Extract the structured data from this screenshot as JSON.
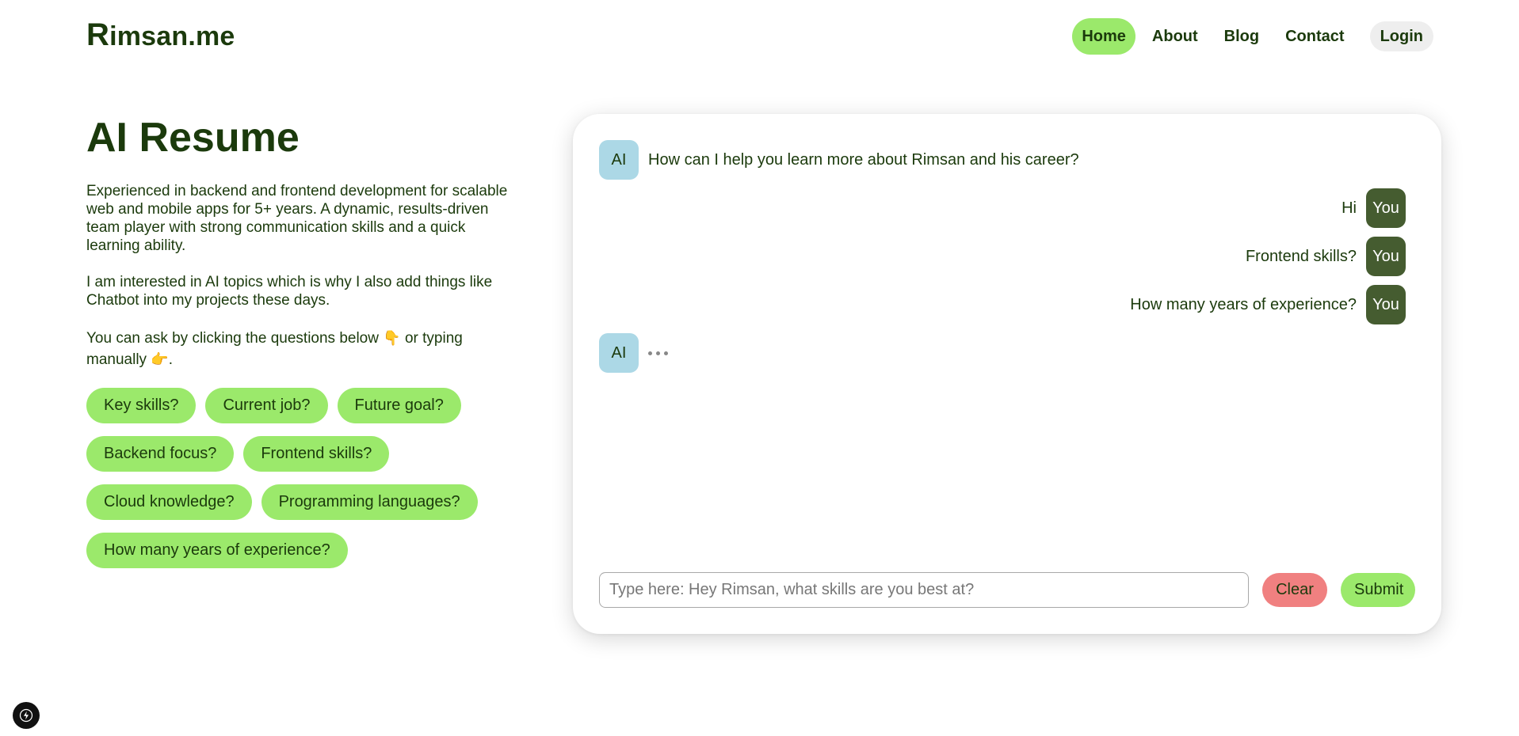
{
  "header": {
    "logo_first": "R",
    "logo_rest": "imsan.me",
    "nav": [
      {
        "label": "Home",
        "active": true
      },
      {
        "label": "About",
        "active": false
      },
      {
        "label": "Blog",
        "active": false
      },
      {
        "label": "Contact",
        "active": false
      }
    ],
    "login_label": "Login"
  },
  "intro": {
    "title": "AI Resume",
    "paragraph1": "Experienced in backend and frontend development for scalable web and mobile apps for 5+ years. A dynamic, results-driven team player with strong communication skills and a quick learning ability.",
    "paragraph2": "I am interested in AI topics which is why I also add things like Chatbot into my projects these days.",
    "paragraph3_part1": "You can ask by clicking the questions below",
    "emoji_down": "👇",
    "paragraph3_part2": "or typing manually",
    "emoji_right": "👉",
    "paragraph3_end": "."
  },
  "suggestions": [
    "Key skills?",
    "Current job?",
    "Future goal?",
    "Backend focus?",
    "Frontend skills?",
    "Cloud knowledge?",
    "Programming languages?",
    "How many years of experience?"
  ],
  "chat": {
    "ai_label": "AI",
    "you_label": "You",
    "messages": [
      {
        "sender": "ai",
        "text": "How can I help you learn more about Rimsan and his career?"
      },
      {
        "sender": "you",
        "text": "Hi"
      },
      {
        "sender": "you",
        "text": "Frontend skills?"
      },
      {
        "sender": "you",
        "text": "How many years of experience?"
      },
      {
        "sender": "ai",
        "text": "",
        "typing": true
      }
    ],
    "input_value": "",
    "input_placeholder": "Type here: Hey Rimsan, what skills are you best at?",
    "clear_label": "Clear",
    "submit_label": "Submit"
  },
  "colors": {
    "accent_green": "#9be96b",
    "text_dark_green": "#1b3a0c",
    "you_avatar": "#455c30",
    "ai_avatar": "#acd8e6",
    "clear_red": "#f08080"
  }
}
